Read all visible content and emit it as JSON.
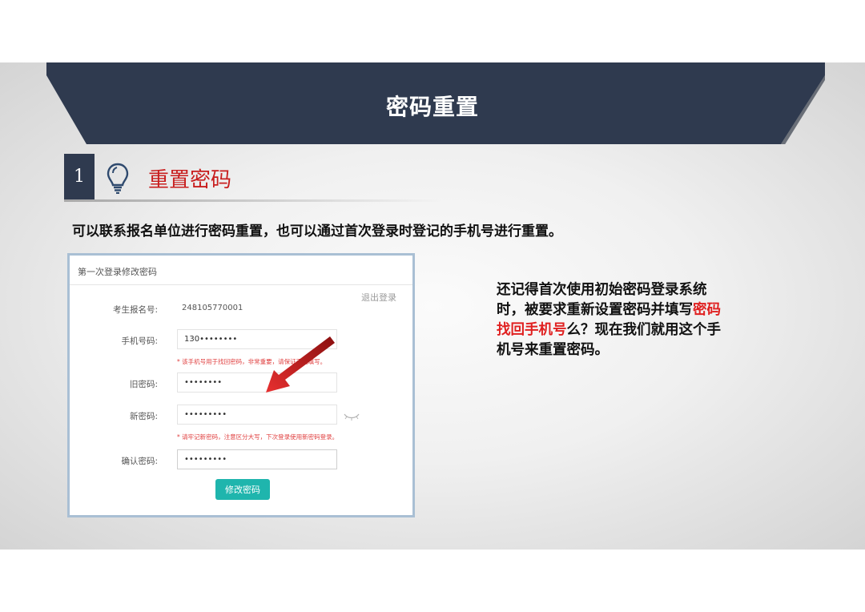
{
  "banner": {
    "title": "密码重置"
  },
  "section": {
    "number": "1",
    "title": "重置密码"
  },
  "intro_text": "可以联系报名单位进行密码重置，也可以通过首次登录时登记的手机号进行重置。",
  "screenshot": {
    "title": "第一次登录修改密码",
    "logout_label": "退出登录",
    "fields": {
      "reg_no": {
        "label": "考生报名号:",
        "value": "248105770001"
      },
      "phone": {
        "label": "手机号码:",
        "value": "130••••••••"
      },
      "phone_note": "* 该手机号用于找回密码，非常重要，请保证正确填写。",
      "old_pwd": {
        "label": "旧密码:",
        "value": "••••••••"
      },
      "new_pwd": {
        "label": "新密码:",
        "value": "•••••••••"
      },
      "new_pwd_note": "* 请牢记新密码，注意区分大写，下次登录使用新密码登录。",
      "confirm_pwd": {
        "label": "确认密码:",
        "value": "•••••••••"
      }
    },
    "submit_label": "修改密码"
  },
  "callout": {
    "before": "还记得首次使用初始密码登录系统时，被要求重新设置密码并填写",
    "highlight": "密码找回手机号",
    "after": "么？现在我们就用这个手机号来重置密码。"
  },
  "colors": {
    "banner": "#2f3a4f",
    "accent_red": "#c81e1e",
    "button": "#1fb5ad"
  },
  "icons": {
    "section": "lightbulb-icon",
    "pointer": "red-arrow-icon",
    "toggle": "eye-closed-icon"
  }
}
